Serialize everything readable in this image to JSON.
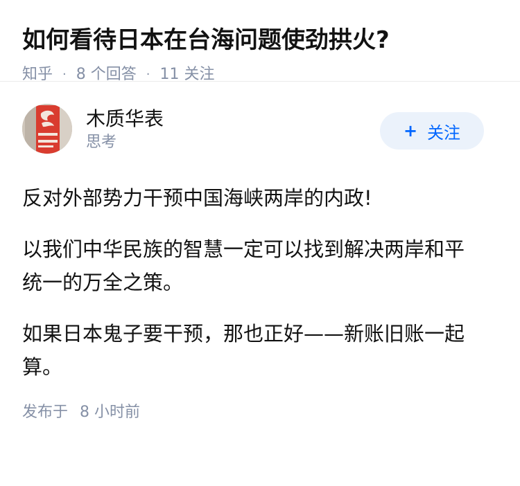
{
  "question": {
    "title": "如何看待日本在台海问题使劲拱火?",
    "source": "知乎",
    "answers_count": "8 个回答",
    "followers_count": "11 关注"
  },
  "answer": {
    "author": {
      "name": "木质华表",
      "bio": "思考"
    },
    "follow_button": {
      "label": "关注",
      "icon": "plus-icon"
    },
    "paragraphs": [
      "反对外部势力干预中国海峡两岸的内政!",
      "以我们中华民族的智慧一定可以找到解决两岸和平统一的万全之策。",
      "如果日本鬼子要干预，那也正好——新账旧账一起算。"
    ],
    "published_label": "发布于",
    "published_time": "8 小时前"
  },
  "colors": {
    "text_primary": "#121212",
    "text_secondary": "#8590a6",
    "brand_blue": "#0066ff",
    "follow_bg": "#ebf2fb",
    "divider": "#ebebeb"
  }
}
